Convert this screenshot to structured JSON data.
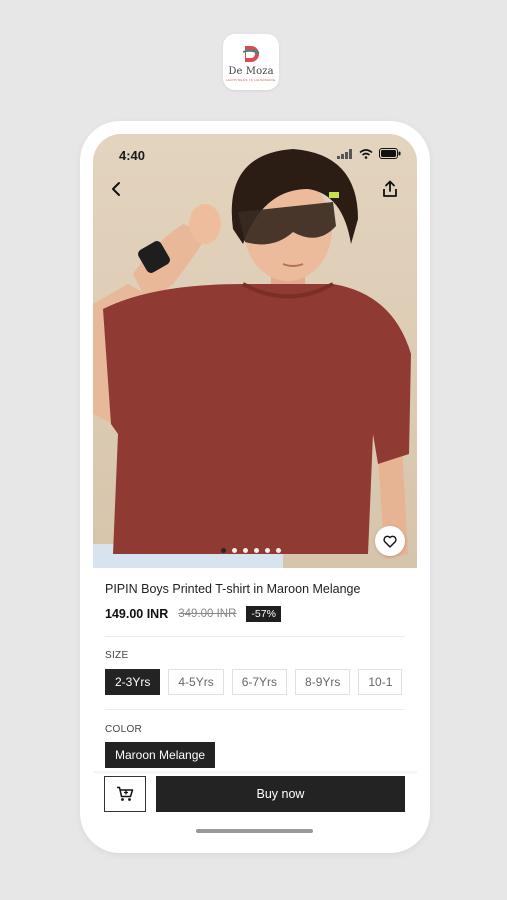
{
  "app": {
    "logo_text": "De Moza",
    "logo_tagline": "HAPPINESS IS HANDMADE"
  },
  "status_bar": {
    "time": "4:40",
    "icons": [
      "signal-icon",
      "wifi-icon",
      "battery-icon"
    ]
  },
  "nav": {
    "back_icon": "chevron-left-icon",
    "share_icon": "share-icon",
    "wishlist_icon": "heart-icon"
  },
  "carousel": {
    "total": 6,
    "active_index": 0
  },
  "product": {
    "title": "PIPIN Boys Printed T-shirt in Maroon Melange",
    "price": "149.00 INR",
    "mrp": "349.00 INR",
    "discount": "-57%"
  },
  "size": {
    "label": "SIZE",
    "options": [
      "2-3Yrs",
      "4-5Yrs",
      "6-7Yrs",
      "8-9Yrs",
      "10-1"
    ],
    "selected_index": 0
  },
  "color": {
    "label": "COLOR",
    "selected": "Maroon Melange"
  },
  "actions": {
    "cart_icon": "cart-icon",
    "buy_label": "Buy now"
  },
  "colors": {
    "accent": "#232323",
    "background": "#e7e7e7",
    "shirt": "#8f3a32"
  }
}
